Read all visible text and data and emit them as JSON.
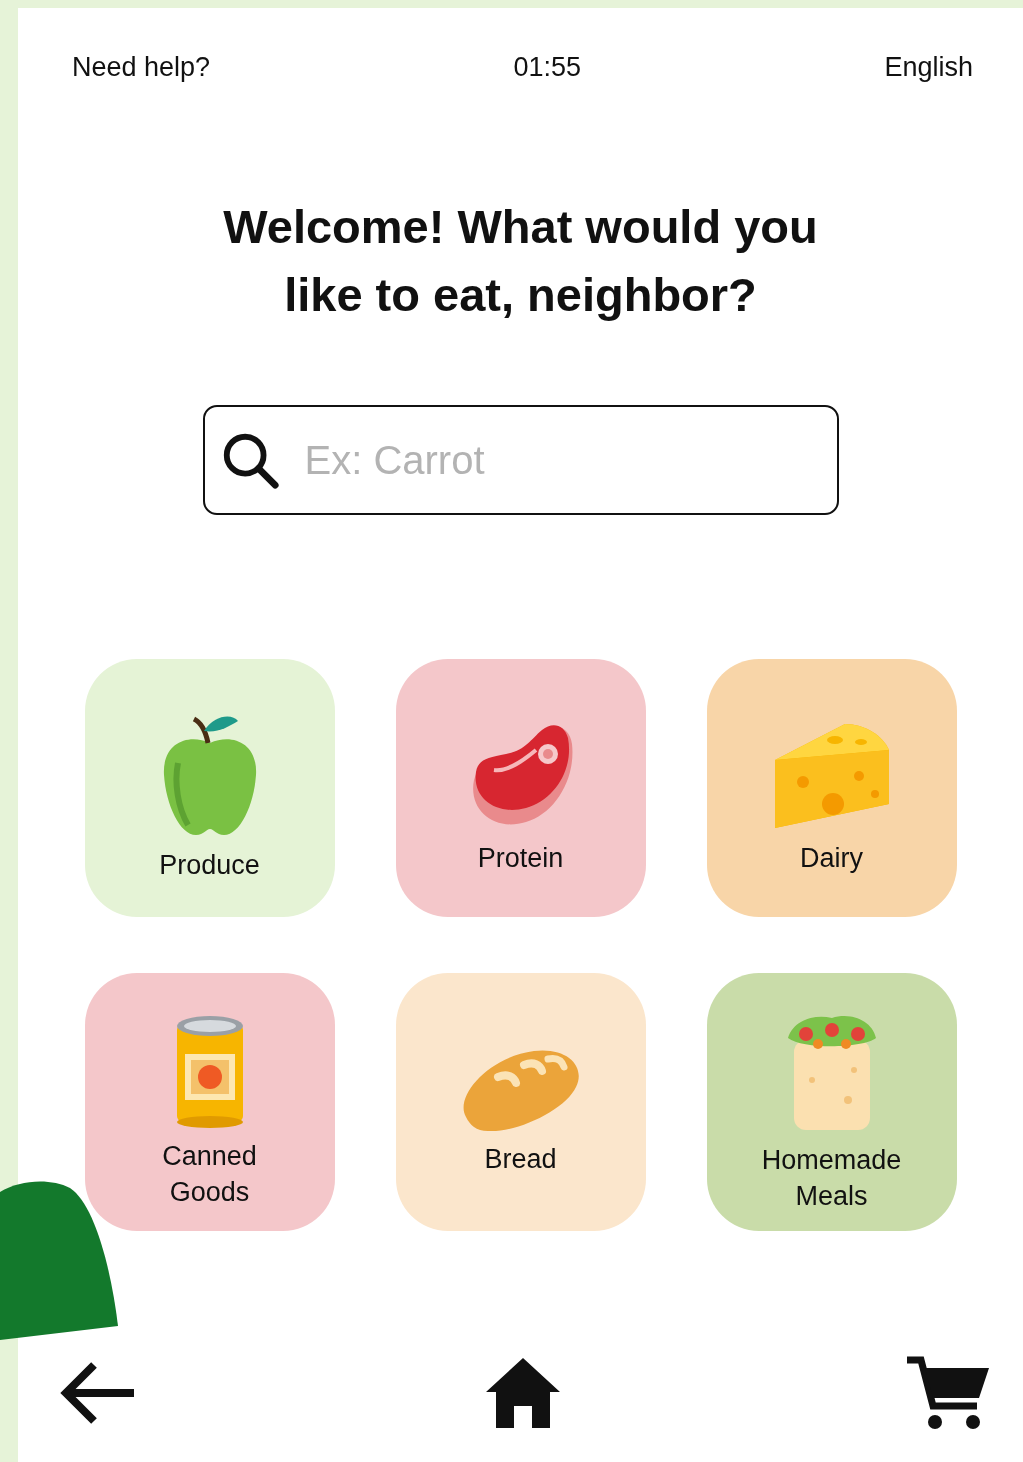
{
  "top_bar": {
    "help": "Need help?",
    "time": "01:55",
    "language": "English"
  },
  "heading": [
    "Welcome! What would you",
    "like to eat, neighbor?"
  ],
  "search": {
    "placeholder": "Ex: Carrot"
  },
  "categories": [
    {
      "label": "Produce",
      "color": "#e5f3d6"
    },
    {
      "label": "Protein",
      "color": "#f4c7ca"
    },
    {
      "label": "Dairy",
      "color": "#f8d5a8"
    },
    {
      "label": "Canned\nGoods",
      "color": "#f4c7ca"
    },
    {
      "label": "Bread",
      "color": "#fbe6cc"
    },
    {
      "label": "Homemade\nMeals",
      "color": "#c9dca9"
    }
  ]
}
